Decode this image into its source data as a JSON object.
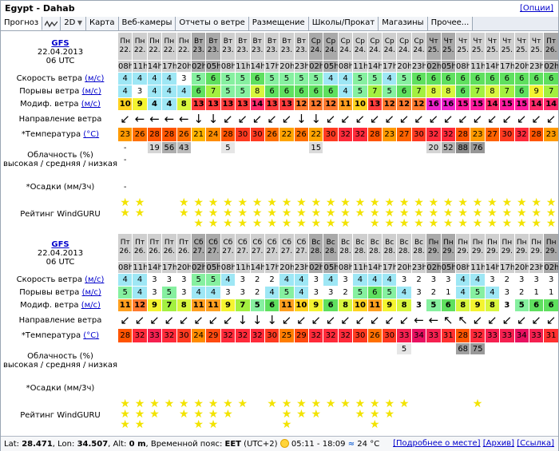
{
  "title": "Egypt - Dahab",
  "options_label": "[Опции]",
  "tabs": [
    {
      "label": "Прогноз",
      "active": true
    },
    {
      "label": "",
      "icon": "wave-chart-icon"
    },
    {
      "label": "2D",
      "dropdown": true
    },
    {
      "label": "Карта"
    },
    {
      "label": "Веб-камеры"
    },
    {
      "label": "Отчеты о ветре"
    },
    {
      "label": "Размещение"
    },
    {
      "label": "Школы/Прокат"
    },
    {
      "label": "Магазины"
    },
    {
      "label": "Прочее..."
    }
  ],
  "row_labels": {
    "wind_speed": "Скорость ветра",
    "gusts": "Порывы ветра",
    "mod_wind": "Модиф. ветра",
    "unit_ms": "(м/с)",
    "direction": "Направление ветра",
    "temperature": "*Температура",
    "unit_c": "(°C)",
    "cloud_line1": "Облачность (%)",
    "cloud_line2": "высокая / средняя / низкая",
    "precip": "*Осадки (мм/3ч)",
    "rating": "Рейтинг WindGURU"
  },
  "blocks": [
    {
      "model": "GFS",
      "run_date": "22.04.2013",
      "run_time": "06 UTC",
      "days": [
        "Пн",
        "Пн",
        "Пн",
        "Пн",
        "Пн",
        "Вт",
        "Вт",
        "Вт",
        "Вт",
        "Вт",
        "Вт",
        "Вт",
        "Вт",
        "Ср",
        "Ср",
        "Ср",
        "Ср",
        "Ср",
        "Ср",
        "Ср",
        "Ср",
        "Чт",
        "Чт",
        "Чт",
        "Чт",
        "Чт",
        "Чт",
        "Чт",
        "Чт",
        "Пт"
      ],
      "dates": [
        "22.",
        "22.",
        "22.",
        "22.",
        "22.",
        "23.",
        "23.",
        "23.",
        "23.",
        "23.",
        "23.",
        "23.",
        "23.",
        "24.",
        "24.",
        "24.",
        "24.",
        "24.",
        "24.",
        "24.",
        "24.",
        "25.",
        "25.",
        "25.",
        "25.",
        "25.",
        "25.",
        "25.",
        "25.",
        "26."
      ],
      "hours": [
        "08h",
        "11h",
        "14h",
        "17h",
        "20h",
        "02h",
        "05h",
        "08h",
        "11h",
        "14h",
        "17h",
        "20h",
        "23h",
        "02h",
        "05h",
        "08h",
        "11h",
        "14h",
        "17h",
        "20h",
        "23h",
        "02h",
        "05h",
        "08h",
        "11h",
        "14h",
        "17h",
        "20h",
        "23h",
        "02h"
      ],
      "wind_speed": [
        4,
        4,
        4,
        4,
        3,
        5,
        6,
        5,
        5,
        6,
        5,
        5,
        5,
        5,
        4,
        4,
        5,
        5,
        4,
        5,
        6,
        6,
        6,
        6,
        6,
        6,
        6,
        6,
        6,
        6
      ],
      "gusts": [
        4,
        3,
        4,
        4,
        4,
        6,
        7,
        5,
        5,
        8,
        6,
        6,
        6,
        6,
        6,
        4,
        5,
        7,
        5,
        6,
        7,
        8,
        8,
        6,
        7,
        8,
        7,
        6,
        9,
        7
      ],
      "mod_wind": [
        10,
        9,
        4,
        4,
        8,
        13,
        13,
        13,
        13,
        14,
        13,
        13,
        12,
        12,
        12,
        11,
        10,
        13,
        12,
        12,
        12,
        16,
        16,
        15,
        15,
        14,
        15,
        15,
        14,
        14
      ],
      "direction": [
        "↙",
        "←",
        "←",
        "←",
        "←",
        "↓",
        "↓",
        "↙",
        "↙",
        "↙",
        "↙",
        "↙",
        "↓",
        "↓",
        "↙",
        "↙",
        "↙",
        "↙",
        "↙",
        "↙",
        "↙",
        "↙",
        "↙",
        "↙",
        "↙",
        "↙",
        "↙",
        "↙",
        "↙",
        "↙"
      ],
      "temperature": [
        23,
        26,
        28,
        28,
        26,
        21,
        24,
        28,
        30,
        30,
        26,
        22,
        26,
        22,
        30,
        32,
        32,
        28,
        23,
        27,
        30,
        32,
        32,
        28,
        23,
        27,
        30,
        32,
        28,
        23
      ],
      "cloud_high": [
        "-",
        "",
        "19",
        "56",
        "43",
        "",
        "",
        "5",
        "",
        "",
        "",
        "",
        "",
        "15",
        "",
        "",
        "",
        "",
        "",
        "",
        "",
        "20",
        "52",
        "88",
        "76",
        "",
        "",
        "",
        "",
        ""
      ],
      "cloud_mid": [
        "-",
        "",
        "",
        "",
        "",
        "",
        "",
        "",
        "",
        "",
        "",
        "",
        "",
        "",
        "",
        "",
        "",
        "",
        "",
        "",
        "",
        "",
        "",
        "",
        "",
        "",
        "",
        "",
        "",
        ""
      ],
      "precip": [
        "-",
        "",
        "",
        "",
        "",
        "",
        "",
        "",
        "",
        "",
        "",
        "",
        "",
        "",
        "",
        "",
        "",
        "",
        "",
        "",
        "",
        "",
        "",
        "",
        "",
        "",
        "",
        "",
        "",
        ""
      ],
      "rating": [
        2,
        2,
        0,
        0,
        2,
        3,
        3,
        3,
        3,
        3,
        3,
        3,
        3,
        3,
        3,
        3,
        2,
        3,
        3,
        3,
        3,
        3,
        3,
        3,
        3,
        3,
        3,
        3,
        3,
        3
      ]
    },
    {
      "model": "GFS",
      "run_date": "22.04.2013",
      "run_time": "06 UTC",
      "days": [
        "Пт",
        "Пт",
        "Пт",
        "Пт",
        "Пт",
        "Сб",
        "Сб",
        "Сб",
        "Сб",
        "Сб",
        "Сб",
        "Сб",
        "Сб",
        "Вс",
        "Вс",
        "Вс",
        "Вс",
        "Вс",
        "Вс",
        "Вс",
        "Вс",
        "Пн",
        "Пн",
        "Пн",
        "Пн",
        "Пн",
        "Пн",
        "Пн",
        "Пн",
        "Пн"
      ],
      "dates": [
        "26.",
        "26.",
        "26.",
        "26.",
        "26.",
        "27.",
        "27.",
        "27.",
        "27.",
        "27.",
        "27.",
        "27.",
        "27.",
        "28.",
        "28.",
        "28.",
        "28.",
        "28.",
        "28.",
        "28.",
        "28.",
        "29.",
        "29.",
        "29.",
        "29.",
        "29.",
        "29.",
        "29.",
        "29.",
        "29."
      ],
      "hours": [
        "08h",
        "11h",
        "14h",
        "17h",
        "20h",
        "02h",
        "05h",
        "08h",
        "11h",
        "14h",
        "17h",
        "20h",
        "23h",
        "02h",
        "05h",
        "08h",
        "11h",
        "14h",
        "17h",
        "20h",
        "23h",
        "02h",
        "05h",
        "08h",
        "11h",
        "14h",
        "17h",
        "20h",
        "23h",
        "02h"
      ],
      "wind_speed": [
        4,
        4,
        3,
        3,
        3,
        5,
        5,
        4,
        3,
        2,
        2,
        4,
        4,
        3,
        4,
        3,
        4,
        4,
        4,
        3,
        2,
        3,
        3,
        4,
        4,
        3,
        2,
        3,
        3,
        3
      ],
      "gusts": [
        5,
        4,
        3,
        5,
        3,
        4,
        4,
        3,
        3,
        2,
        4,
        5,
        4,
        3,
        3,
        2,
        5,
        6,
        5,
        4,
        3,
        2,
        1,
        4,
        5,
        4,
        3,
        2,
        1,
        1
      ],
      "mod_wind": [
        11,
        12,
        9,
        7,
        8,
        11,
        11,
        9,
        7,
        5,
        6,
        11,
        10,
        9,
        6,
        8,
        10,
        11,
        9,
        8,
        3,
        5,
        6,
        8,
        9,
        8,
        3,
        5,
        6,
        6
      ],
      "direction": [
        "↙",
        "↙",
        "↙",
        "↙",
        "↙",
        "↙",
        "↙",
        "↙",
        "↓",
        "↓",
        "↓",
        "↙",
        "↙",
        "↙",
        "↙",
        "↙",
        "↙",
        "↙",
        "↙",
        "↙",
        "←",
        "←",
        "↖",
        "↖",
        "↙",
        "↙",
        "↙",
        "↙",
        "↙",
        "↙"
      ],
      "temperature": [
        28,
        32,
        33,
        32,
        30,
        24,
        29,
        32,
        32,
        32,
        30,
        25,
        29,
        32,
        32,
        32,
        30,
        26,
        30,
        33,
        34,
        33,
        31,
        28,
        32,
        33,
        33,
        34,
        33,
        31
      ],
      "cloud_high": [
        "",
        "",
        "",
        "",
        "",
        "",
        "",
        "",
        "",
        "",
        "",
        "",
        "",
        "",
        "",
        "",
        "",
        "",
        "",
        "5",
        "",
        "",
        "",
        "68",
        "75",
        "",
        "",
        "",
        "",
        ""
      ],
      "cloud_mid": [
        "",
        "",
        "",
        "",
        "",
        "",
        "",
        "",
        "",
        "",
        "",
        "",
        "",
        "",
        "",
        "",
        "",
        "",
        "",
        "",
        "",
        "",
        "",
        "",
        "",
        "",
        "",
        "",
        "",
        ""
      ],
      "precip": [
        "",
        "",
        "",
        "",
        "",
        "",
        "",
        "",
        "",
        "",
        "",
        "",
        "",
        "",
        "",
        "",
        "",
        "",
        "",
        "",
        "",
        "",
        "",
        "",
        "",
        "",
        "",
        "",
        "",
        ""
      ],
      "rating": [
        3,
        3,
        2,
        1,
        2,
        3,
        3,
        2,
        1,
        0,
        1,
        3,
        2,
        2,
        1,
        1,
        2,
        3,
        2,
        1,
        0,
        0,
        0,
        0,
        1,
        0,
        0,
        0,
        0,
        0
      ]
    }
  ],
  "footer": {
    "lat_label": "Lat:",
    "lat": "28.471",
    "lon_label": "Lon:",
    "lon": "34.507",
    "alt_label": "Alt:",
    "alt": "0 m",
    "tz_label": "Временной пояс:",
    "tz": "EET",
    "tz_offset": "(UTC+2)",
    "sun_times": "05:11 - 18:09",
    "water_temp": "24 °C",
    "link_details": "[Подробнее о месте]",
    "link_archive": "[Архив]",
    "link_url": "[Ссылка]"
  },
  "colors": {
    "wind_scale": {
      "1": "#ffffff",
      "2": "#ffffff",
      "3": "#ffffff",
      "4": "#9ee7f5",
      "5": "#86f0a0",
      "6": "#5fe05f",
      "7": "#a3f040",
      "8": "#d8f63e",
      "9": "#f4f430",
      "10": "#ffd21f",
      "11": "#ff9f1f",
      "12": "#ff7a2e",
      "13": "#ff3c3c",
      "14": "#ff2a6a",
      "15": "#ff1a9f",
      "16": "#ee22cc"
    },
    "temp_scale": {
      "21": "#ffb400",
      "22": "#ffa400",
      "23": "#ff9a00",
      "24": "#ff8c00",
      "25": "#ff7e00",
      "26": "#ff7000",
      "27": "#ff6200",
      "28": "#ff5400",
      "29": "#ff4a10",
      "30": "#ff3a20",
      "31": "#ff3030",
      "32": "#ff2a3a",
      "33": "#f52050",
      "34": "#e81060"
    },
    "cloud": "#9a9a9a",
    "star": "#f2e300"
  }
}
